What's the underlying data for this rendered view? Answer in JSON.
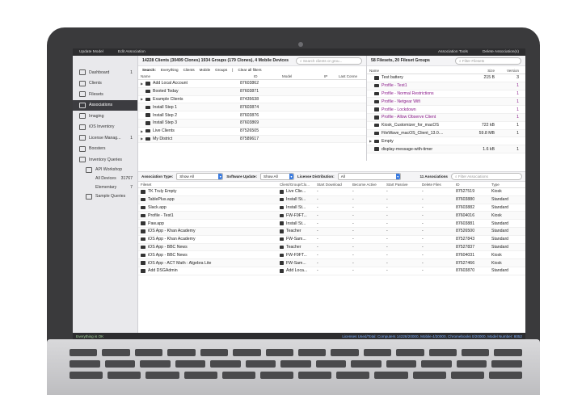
{
  "menubar": {
    "left": [
      "Update Model",
      "Edit Association"
    ],
    "right": [
      "Association Tools",
      "Delete Association(s)"
    ]
  },
  "sidebar": {
    "items": [
      {
        "label": "Dashboard",
        "badge": "1",
        "icon": "dashboard-icon"
      },
      {
        "label": "Clients",
        "badge": "",
        "icon": "clients-icon"
      },
      {
        "label": "Filesets",
        "badge": "",
        "icon": "filesets-icon"
      },
      {
        "label": "Associations",
        "badge": "",
        "icon": "associations-icon"
      },
      {
        "label": "Imaging",
        "badge": "",
        "icon": "imaging-icon"
      },
      {
        "label": "iOS Inventory",
        "badge": "",
        "icon": "ios-inventory-icon"
      },
      {
        "label": "License Manag...",
        "badge": "1",
        "icon": "license-icon"
      },
      {
        "label": "Boosters",
        "badge": "",
        "icon": "boosters-icon"
      },
      {
        "label": "Inventory Queries",
        "badge": "",
        "icon": "inventory-queries-icon"
      }
    ],
    "sub": [
      {
        "label": "API Workshop",
        "badge": "",
        "icon": "folder-icon"
      },
      {
        "label": "All Devices",
        "badge": "31767"
      },
      {
        "label": "Elementary",
        "badge": "7"
      },
      {
        "label": "Sample Queries",
        "badge": "",
        "icon": "folder-icon"
      }
    ]
  },
  "clients": {
    "summary": "14228 Clients (30499 Clones) 1934 Groups (179 Clones), 4 Mobile Devices",
    "search_placeholder": "Search clients or grou...",
    "filters_label": "Search:",
    "filters": [
      "Everything",
      "Clients",
      "Mobile",
      "Groups",
      "|",
      "Clear all filters"
    ],
    "columns": [
      "Name",
      "ID",
      "Model",
      "IP",
      "Last Conne"
    ],
    "rows": [
      {
        "name": "Add Local Account",
        "id": "87603862",
        "tri": "▶"
      },
      {
        "name": "Booted Today",
        "id": "87603871",
        "tri": ""
      },
      {
        "name": "Example Clients",
        "id": "87435638",
        "tri": "▶"
      },
      {
        "name": "Install Step 1",
        "id": "87603874",
        "tri": ""
      },
      {
        "name": "Install Step 2",
        "id": "87603876",
        "tri": ""
      },
      {
        "name": "Install Step 3",
        "id": "87603869",
        "tri": ""
      },
      {
        "name": "Live Clients",
        "id": "87526505",
        "tri": "▶"
      },
      {
        "name": "My District",
        "id": "87589617",
        "tri": "▶"
      }
    ]
  },
  "filesets": {
    "summary": "58 Filesets, 20 Fileset Groups",
    "search_placeholder": "Filter Filesets",
    "columns": [
      "Name",
      "Size",
      "Version"
    ],
    "rows": [
      {
        "name": "Test battery",
        "size": "215 B",
        "version": "3",
        "purple": false,
        "tri": ""
      },
      {
        "name": "Profile - Test1",
        "size": "",
        "version": "1",
        "purple": true,
        "tri": ""
      },
      {
        "name": "Profile - Normal Restrictions",
        "size": "",
        "version": "1",
        "purple": true,
        "tri": ""
      },
      {
        "name": "Profile - Netgear Wifi",
        "size": "",
        "version": "1",
        "purple": true,
        "tri": ""
      },
      {
        "name": "Profile - Lockdown",
        "size": "",
        "version": "1",
        "purple": true,
        "tri": ""
      },
      {
        "name": "Profile - Allow Observe Client",
        "size": "",
        "version": "1",
        "purple": true,
        "tri": ""
      },
      {
        "name": "Kiosk_Customizer_for_macOS",
        "size": "722 kB",
        "version": "1",
        "purple": false,
        "tri": ""
      },
      {
        "name": "FileWave_macOS_Client_13.0....",
        "size": "59.8 MB",
        "version": "1",
        "purple": false,
        "tri": ""
      },
      {
        "name": "Empty",
        "size": "",
        "version": "",
        "purple": false,
        "tri": "▶"
      },
      {
        "name": "display-message-with-timer",
        "size": "1.6 kB",
        "version": "1",
        "purple": false,
        "tri": ""
      }
    ]
  },
  "assoc_bar": {
    "type_label": "Association Type:",
    "type_value": "Show All",
    "update_label": "Software Update:",
    "update_value": "Show All",
    "license_label": "License Distribution:",
    "license_value": "All",
    "count": "11 Associations",
    "search_placeholder": "Filter Associations"
  },
  "assoc": {
    "columns": [
      "Fileset",
      "Client/Group/Clo...",
      "Start Download",
      "Become Active",
      "Start Passive",
      "Delete Files",
      "ID",
      "Type"
    ],
    "rows": [
      {
        "fileset": "TK Truly Empty",
        "client": "Live Clie...",
        "sd": "-",
        "ba": "-",
        "sp": "-",
        "df": "-",
        "id": "87527519",
        "type": "Kiosk"
      },
      {
        "fileset": "TablePlus.app",
        "client": "Install St...",
        "sd": "-",
        "ba": "-",
        "sp": "-",
        "df": "-",
        "id": "87603880",
        "type": "Standard"
      },
      {
        "fileset": "Slack.app",
        "client": "Install St...",
        "sd": "-",
        "ba": "-",
        "sp": "-",
        "df": "-",
        "id": "87603882",
        "type": "Standard"
      },
      {
        "fileset": "Profile - Test1",
        "client": "FW-F9FT...",
        "sd": "-",
        "ba": "-",
        "sp": "-",
        "df": "-",
        "id": "87604016",
        "type": "Kiosk"
      },
      {
        "fileset": "Paw.app",
        "client": "Install St...",
        "sd": "-",
        "ba": "-",
        "sp": "-",
        "df": "-",
        "id": "87603881",
        "type": "Standard"
      },
      {
        "fileset": "iOS App - Khan Academy",
        "client": "Teacher",
        "sd": "-",
        "ba": "-",
        "sp": "-",
        "df": "-",
        "id": "87526500",
        "type": "Standard"
      },
      {
        "fileset": "iOS App - Khan Academy",
        "client": "FW-Sam...",
        "sd": "-",
        "ba": "-",
        "sp": "-",
        "df": "-",
        "id": "87527843",
        "type": "Standard"
      },
      {
        "fileset": "iOS App - BBC News",
        "client": "Teacher",
        "sd": "-",
        "ba": "-",
        "sp": "-",
        "df": "-",
        "id": "87527837",
        "type": "Standard"
      },
      {
        "fileset": "iOS App - BBC News",
        "client": "FW-F9FT...",
        "sd": "-",
        "ba": "-",
        "sp": "-",
        "df": "-",
        "id": "87604031",
        "type": "Kiosk"
      },
      {
        "fileset": "iOS App - ACT Math : Algebra Lite",
        "client": "FW-Sam...",
        "sd": "-",
        "ba": "-",
        "sp": "-",
        "df": "-",
        "id": "87527466",
        "type": "Kiosk"
      },
      {
        "fileset": "Add DSGAdmin",
        "client": "Add Loca...",
        "sd": "-",
        "ba": "-",
        "sp": "-",
        "df": "-",
        "id": "87603870",
        "type": "Standard"
      }
    ]
  },
  "status": {
    "left": "Everything is OK",
    "right": "Licenses Used/Total: Computers 14228/20000, Mobile 4/20000, Chromebooks 0/20000, Model Number: 8052"
  }
}
